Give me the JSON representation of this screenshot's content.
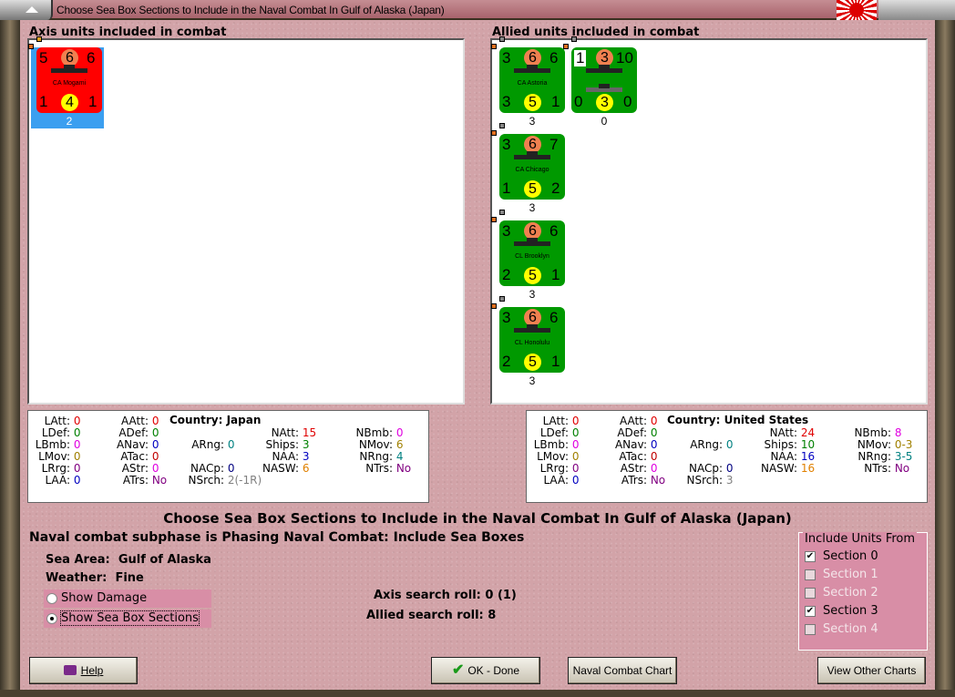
{
  "window": {
    "title": "Choose Sea Box Sections to Include in the Naval Combat In Gulf of Alaska (Japan)"
  },
  "axis": {
    "heading": "Axis units included in combat",
    "units": [
      {
        "name": "CA Mogami",
        "tl": "5",
        "top": "6",
        "tr": "6",
        "bl": "1",
        "bottom": "4",
        "br": "1",
        "count": "2",
        "color": "#ff0000"
      }
    ]
  },
  "allied": {
    "heading": "Allied units included in combat",
    "units": [
      {
        "name": "CA Astoria",
        "tl": "3",
        "top": "6",
        "tr": "6",
        "bl": "3",
        "bottom": "5",
        "br": "1",
        "count": "3",
        "color": "#009900"
      },
      {
        "name": "",
        "tl": "1",
        "top": "3",
        "tr": "10",
        "bl": "0",
        "bottom": "3",
        "br": "0",
        "count": "0",
        "color": "#009900"
      },
      {
        "name": "CA Chicago",
        "tl": "3",
        "top": "6",
        "tr": "7",
        "bl": "1",
        "bottom": "5",
        "br": "2",
        "count": "3",
        "color": "#009900"
      },
      {
        "name": "CL Brooklyn",
        "tl": "3",
        "top": "6",
        "tr": "6",
        "bl": "2",
        "bottom": "5",
        "br": "1",
        "count": "3",
        "color": "#009900"
      },
      {
        "name": "CL Honolulu",
        "tl": "3",
        "top": "6",
        "tr": "6",
        "bl": "2",
        "bottom": "5",
        "br": "1",
        "count": "3",
        "color": "#009900"
      }
    ]
  },
  "axis_stats": {
    "country": "Country: Japan",
    "items": [
      {
        "k": "LAtt",
        "label": "LAtt:",
        "value": "0",
        "color": "#e00000"
      },
      {
        "k": "LDef",
        "label": "LDef:",
        "value": "0",
        "color": "#008000"
      },
      {
        "k": "LBmb",
        "label": "LBmb:",
        "value": "0",
        "color": "#e000e0"
      },
      {
        "k": "LMov",
        "label": "LMov:",
        "value": "0",
        "color": "#a08000"
      },
      {
        "k": "LRrg",
        "label": "LRrg:",
        "value": "0",
        "color": "#800080"
      },
      {
        "k": "LAA",
        "label": "LAA:",
        "value": "0",
        "color": "#0000c0"
      },
      {
        "k": "AAtt",
        "label": "AAtt:",
        "value": "0",
        "color": "#e00000"
      },
      {
        "k": "ADef",
        "label": "ADef:",
        "value": "0",
        "color": "#008000"
      },
      {
        "k": "ANav",
        "label": "ANav:",
        "value": "0",
        "color": "#0000c0"
      },
      {
        "k": "ATac",
        "label": "ATac:",
        "value": "0",
        "color": "#c00000"
      },
      {
        "k": "AStr",
        "label": "AStr:",
        "value": "0",
        "color": "#e000e0"
      },
      {
        "k": "ATrs",
        "label": "ATrs:",
        "value": "No",
        "color": "#800080"
      },
      {
        "k": "ARng",
        "label": "ARng:",
        "value": "0",
        "color": "#008080"
      },
      {
        "k": "NACp",
        "label": "NACp:",
        "value": "0",
        "color": "#000080"
      },
      {
        "k": "NSrch",
        "label": "NSrch:",
        "value": "2(-1R)",
        "color": "#808080"
      },
      {
        "k": "NAtt",
        "label": "NAtt:",
        "value": "15",
        "color": "#e00000"
      },
      {
        "k": "Ships",
        "label": "Ships:",
        "value": "3",
        "color": "#008000"
      },
      {
        "k": "NAA",
        "label": "NAA:",
        "value": "3",
        "color": "#0000c0"
      },
      {
        "k": "NASW",
        "label": "NASW:",
        "value": "6",
        "color": "#e08000"
      },
      {
        "k": "NBmb",
        "label": "NBmb:",
        "value": "0",
        "color": "#e000e0"
      },
      {
        "k": "NMov",
        "label": "NMov:",
        "value": "6",
        "color": "#a08000"
      },
      {
        "k": "NRng",
        "label": "NRng:",
        "value": "4",
        "color": "#008080"
      },
      {
        "k": "NTrs",
        "label": "NTrs:",
        "value": "No",
        "color": "#800080"
      }
    ]
  },
  "allied_stats": {
    "country": "Country: United States",
    "items": [
      {
        "k": "LAtt",
        "label": "LAtt:",
        "value": "0",
        "color": "#e00000"
      },
      {
        "k": "LDef",
        "label": "LDef:",
        "value": "0",
        "color": "#008000"
      },
      {
        "k": "LBmb",
        "label": "LBmb:",
        "value": "0",
        "color": "#e000e0"
      },
      {
        "k": "LMov",
        "label": "LMov:",
        "value": "0",
        "color": "#a08000"
      },
      {
        "k": "LRrg",
        "label": "LRrg:",
        "value": "0",
        "color": "#800080"
      },
      {
        "k": "LAA",
        "label": "LAA:",
        "value": "0",
        "color": "#0000c0"
      },
      {
        "k": "AAtt",
        "label": "AAtt:",
        "value": "0",
        "color": "#e00000"
      },
      {
        "k": "ADef",
        "label": "ADef:",
        "value": "0",
        "color": "#008000"
      },
      {
        "k": "ANav",
        "label": "ANav:",
        "value": "0",
        "color": "#0000c0"
      },
      {
        "k": "ATac",
        "label": "ATac:",
        "value": "0",
        "color": "#c00000"
      },
      {
        "k": "AStr",
        "label": "AStr:",
        "value": "0",
        "color": "#e000e0"
      },
      {
        "k": "ATrs",
        "label": "ATrs:",
        "value": "No",
        "color": "#800080"
      },
      {
        "k": "ARng",
        "label": "ARng:",
        "value": "0",
        "color": "#008080"
      },
      {
        "k": "NACp",
        "label": "NACp:",
        "value": "0",
        "color": "#000080"
      },
      {
        "k": "NSrch",
        "label": "NSrch:",
        "value": "3",
        "color": "#808080"
      },
      {
        "k": "NAtt",
        "label": "NAtt:",
        "value": "24",
        "color": "#e00000"
      },
      {
        "k": "Ships",
        "label": "Ships:",
        "value": "10",
        "color": "#008000"
      },
      {
        "k": "NAA",
        "label": "NAA:",
        "value": "16",
        "color": "#0000c0"
      },
      {
        "k": "NASW",
        "label": "NASW:",
        "value": "16",
        "color": "#e08000"
      },
      {
        "k": "NBmb",
        "label": "NBmb:",
        "value": "8",
        "color": "#e000e0"
      },
      {
        "k": "NMov",
        "label": "NMov:",
        "value": "0-3",
        "color": "#a08000"
      },
      {
        "k": "NRng",
        "label": "NRng:",
        "value": "3-5",
        "color": "#008080"
      },
      {
        "k": "NTrs",
        "label": "NTrs:",
        "value": "No",
        "color": "#800080"
      }
    ]
  },
  "main": {
    "title": "Choose Sea Box Sections to Include in the Naval Combat In Gulf of Alaska (Japan)",
    "subphase": "Naval combat subphase is Phasing Naval Combat: Include Sea Boxes",
    "sea_area_label": "Sea Area:",
    "sea_area": "Gulf of Alaska",
    "weather_label": "Weather:",
    "weather": "Fine",
    "show_damage": "Show Damage",
    "show_sections": "Show Sea Box Sections",
    "axis_search": "Axis search roll: 0 (1)",
    "allied_search": "Allied search roll: 8"
  },
  "include": {
    "legend": "Include Units From",
    "sections": [
      {
        "label": "Section 0",
        "checked": true,
        "enabled": true
      },
      {
        "label": "Section 1",
        "checked": false,
        "enabled": false
      },
      {
        "label": "Section 2",
        "checked": false,
        "enabled": false
      },
      {
        "label": "Section 3",
        "checked": true,
        "enabled": true
      },
      {
        "label": "Section 4",
        "checked": false,
        "enabled": false
      }
    ]
  },
  "buttons": {
    "help": "Help",
    "ok": "OK - Done",
    "naval_chart": "Naval Combat Chart",
    "other_charts": "View Other Charts"
  }
}
